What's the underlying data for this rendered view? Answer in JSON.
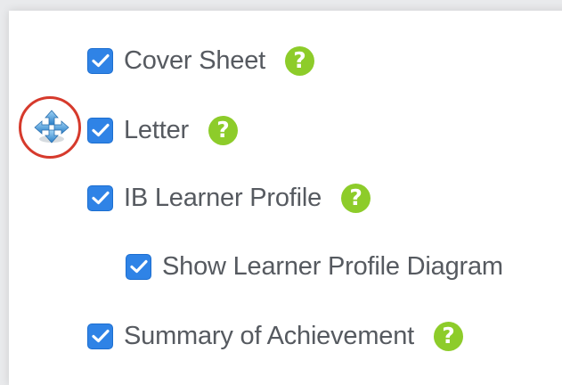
{
  "sections": [
    {
      "label": "Cover Sheet",
      "checked": true,
      "help_glyph": "?"
    },
    {
      "label": "Letter",
      "checked": true,
      "help_glyph": "?"
    },
    {
      "label": "IB Learner Profile",
      "checked": true,
      "help_glyph": "?"
    },
    {
      "label": "Show Learner Profile Diagram",
      "checked": true
    },
    {
      "label": "Summary of Achievement",
      "checked": true,
      "help_glyph": "?"
    }
  ],
  "icons": {
    "checkbox": "checkmark-icon",
    "help": "question-mark-icon",
    "drag": "move-arrows-icon"
  },
  "colors": {
    "checkbox": "#2f83e6",
    "help": "#8dcc2a",
    "highlight_ring": "#d63a2c",
    "label_text": "#565a60"
  }
}
